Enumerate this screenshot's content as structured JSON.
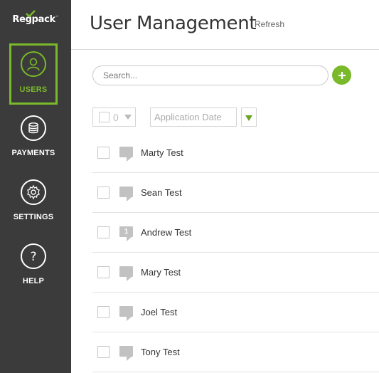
{
  "brand": {
    "name": "Regpack",
    "trademark": "™"
  },
  "sidebar": {
    "items": [
      {
        "label": "USERS",
        "icon": "user-icon",
        "active": true
      },
      {
        "label": "PAYMENTS",
        "icon": "coins-icon",
        "active": false
      },
      {
        "label": "SETTINGS",
        "icon": "gear-icon",
        "active": false
      },
      {
        "label": "HELP",
        "icon": "question-icon",
        "active": false
      }
    ]
  },
  "header": {
    "title": "User Management",
    "refresh_label": "Refresh"
  },
  "search": {
    "placeholder": "Search...",
    "value": ""
  },
  "filters": {
    "selected_count": "0",
    "sort_field": "Application Date"
  },
  "users": [
    {
      "name": "Marty Test",
      "comments": ""
    },
    {
      "name": "Sean Test",
      "comments": ""
    },
    {
      "name": "Andrew Test",
      "comments": "1"
    },
    {
      "name": "Mary Test",
      "comments": ""
    },
    {
      "name": "Joel Test",
      "comments": ""
    },
    {
      "name": "Tony Test",
      "comments": ""
    }
  ],
  "colors": {
    "accent": "#7ab929",
    "sidebar_bg": "#3b3b3b",
    "text": "#333333"
  }
}
